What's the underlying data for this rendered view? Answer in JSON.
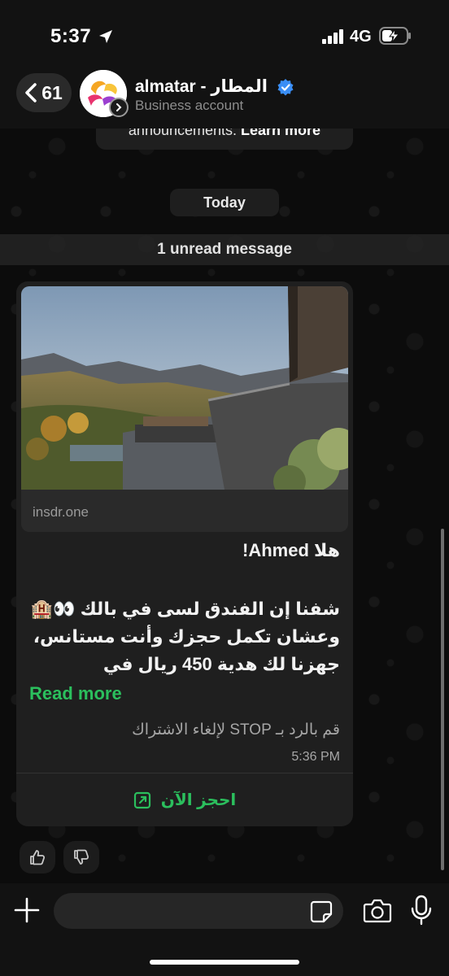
{
  "status_bar": {
    "time": "5:37",
    "network": "4G"
  },
  "header": {
    "back_count": "61",
    "contact_name": "almatar - المطار",
    "subtitle": "Business account"
  },
  "system_notice": {
    "text": "announcements.",
    "link": "Learn more"
  },
  "date_chip": "Today",
  "unread_banner": "1 unread message",
  "message": {
    "link_preview_domain": "insdr.one",
    "greeting": "هلا Ahmed!",
    "body_line1": "شفنا إن الفندق لسى في بالك 👀🏨",
    "body_line2": "وعشان تكمل حجزك وأنت مستانس،",
    "body_line3": "جهزنا لك هدية 450 ريال في",
    "read_more": "Read more",
    "unsubscribe_note": "قم بالرد بـ STOP لإلغاء الاشتراك",
    "time": "5:36 PM",
    "cta_label": "احجز الآن"
  },
  "composer": {
    "placeholder": ""
  },
  "colors": {
    "accent_green": "#2bbf5d",
    "bubble": "#1f1f1f",
    "header": "#121212",
    "verified_blue": "#3a8ef6"
  }
}
